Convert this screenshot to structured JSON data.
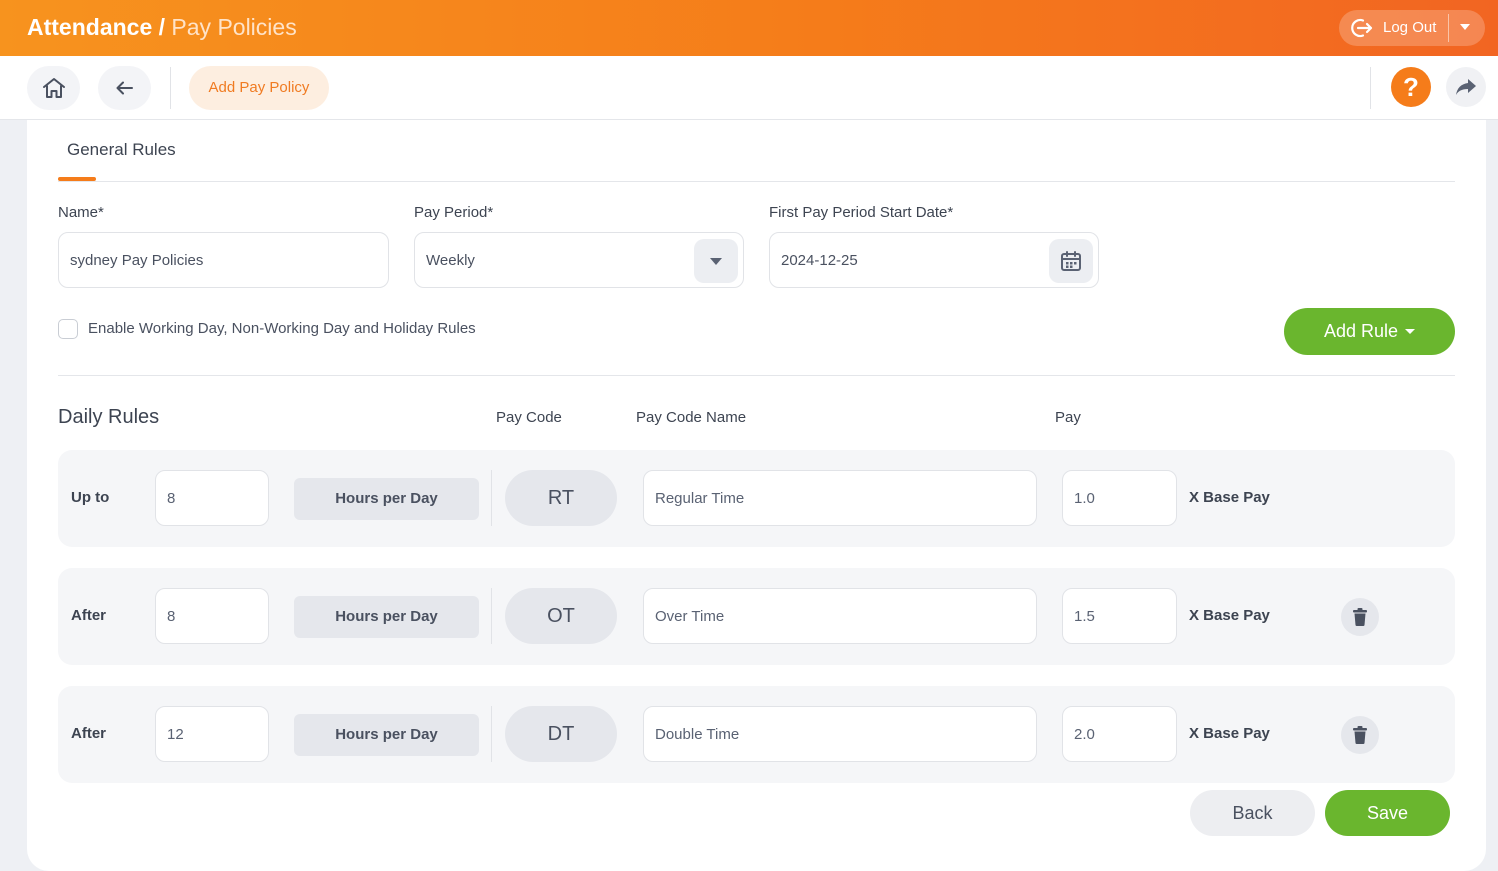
{
  "header": {
    "title_main": "Attendance",
    "title_sep": " / ",
    "title_sub": "Pay Policies",
    "logout_label": "Log Out"
  },
  "toolbar": {
    "add_policy_label": "Add Pay Policy",
    "help_label": "?"
  },
  "tabs": [
    {
      "label": "General Rules",
      "active": true
    }
  ],
  "form": {
    "name_label": "Name*",
    "name_value": "sydney Pay Policies",
    "pay_period_label": "Pay Period*",
    "pay_period_value": "Weekly",
    "start_date_label": "First Pay Period Start Date*",
    "start_date_value": "2024-12-25",
    "enable_rules_label": "Enable Working Day, Non-Working Day and Holiday Rules",
    "enable_rules_checked": false,
    "add_rule_label": "Add Rule"
  },
  "daily_rules": {
    "title": "Daily Rules",
    "columns": {
      "pay_code": "Pay Code",
      "pay_code_name": "Pay Code Name",
      "pay": "Pay"
    },
    "rows": [
      {
        "condition": "Up to",
        "hours": "8",
        "unit": "Hours per Day",
        "code": "RT",
        "code_name": "Regular Time",
        "multiplier": "1.0",
        "suffix": "X Base Pay",
        "deletable": false
      },
      {
        "condition": "After",
        "hours": "8",
        "unit": "Hours per Day",
        "code": "OT",
        "code_name": "Over Time",
        "multiplier": "1.5",
        "suffix": "X Base Pay",
        "deletable": true
      },
      {
        "condition": "After",
        "hours": "12",
        "unit": "Hours per Day",
        "code": "DT",
        "code_name": "Double Time",
        "multiplier": "2.0",
        "suffix": "X Base Pay",
        "deletable": true
      }
    ]
  },
  "actions": {
    "back_label": "Back",
    "save_label": "Save"
  },
  "colors": {
    "accent_orange": "#f57c1a",
    "accent_green": "#6ab62e"
  },
  "icons": {
    "home": "home-icon",
    "back": "arrow-left-icon",
    "help": "help-icon",
    "share": "share-icon",
    "logout": "logout-icon",
    "calendar": "calendar-icon",
    "trash": "trash-icon"
  }
}
